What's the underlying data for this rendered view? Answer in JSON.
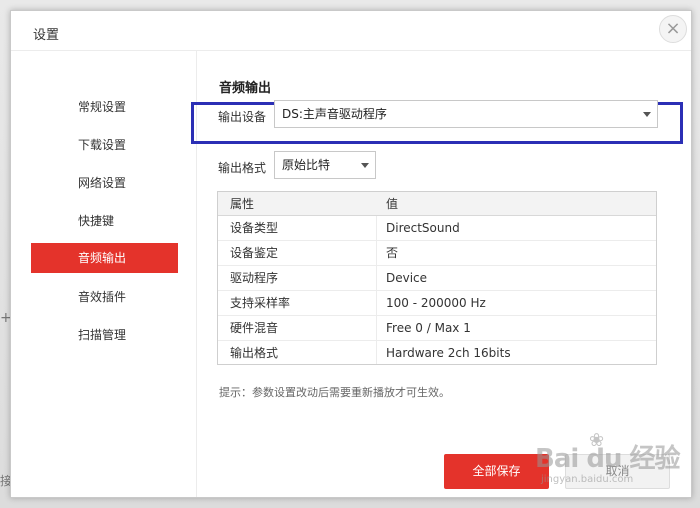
{
  "background": {
    "glyph1": "+",
    "glyph2": "接"
  },
  "dialog": {
    "title": "设置",
    "close_label": "×"
  },
  "sidebar": {
    "items": [
      {
        "label": "常规设置",
        "active": false
      },
      {
        "label": "下载设置",
        "active": false
      },
      {
        "label": "网络设置",
        "active": false
      },
      {
        "label": "快捷键",
        "active": false
      },
      {
        "label": "音频输出",
        "active": true
      },
      {
        "label": "音效插件",
        "active": false
      },
      {
        "label": "扫描管理",
        "active": false
      }
    ]
  },
  "content": {
    "section_title": "音频输出",
    "output_device": {
      "label": "输出设备",
      "value": "DS:主声音驱动程序"
    },
    "output_format": {
      "label": "输出格式",
      "value": "原始比特"
    },
    "table": {
      "columns": [
        "属性",
        "值"
      ],
      "rows": [
        [
          "设备类型",
          "DirectSound"
        ],
        [
          "设备鉴定",
          "否"
        ],
        [
          "驱动程序",
          "Device"
        ],
        [
          "支持采样率",
          "100 - 200000 Hz"
        ],
        [
          "硬件混音",
          "Free 0 / Max 1"
        ],
        [
          "输出格式",
          "Hardware 2ch 16bits"
        ]
      ]
    },
    "hint": "提示：参数设置改动后需要重新播放才可生效。"
  },
  "buttons": {
    "save": "全部保存",
    "cancel": "取消"
  },
  "watermark": {
    "main": "Bai du 经验",
    "sub": "jingyan.baidu.com"
  },
  "colors": {
    "accent": "#e4332b",
    "highlight_box": "#2b2fb5"
  }
}
